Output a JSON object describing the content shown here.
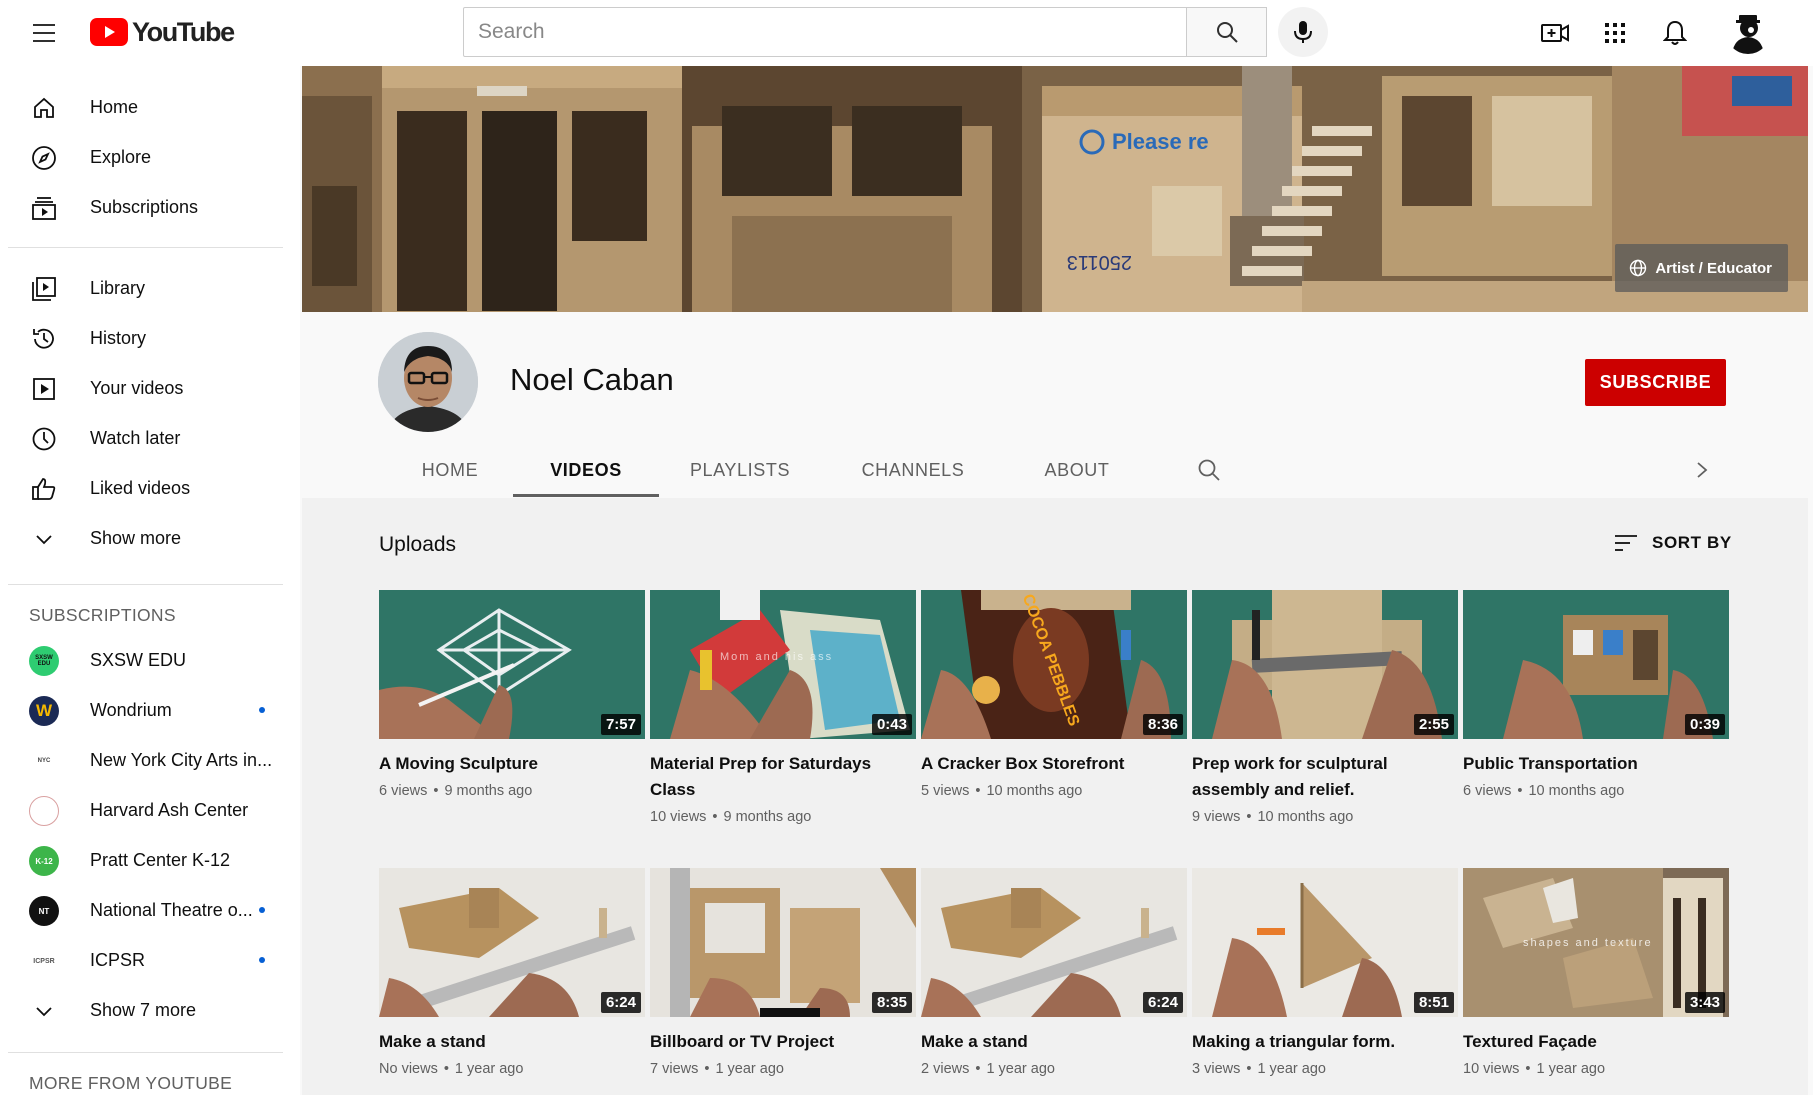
{
  "header": {
    "logo_text": "YouTube",
    "search_placeholder": "Search"
  },
  "sidebar": {
    "main": [
      {
        "label": "Home",
        "icon": "home-icon"
      },
      {
        "label": "Explore",
        "icon": "compass-icon"
      },
      {
        "label": "Subscriptions",
        "icon": "subscriptions-icon"
      }
    ],
    "library": [
      {
        "label": "Library",
        "icon": "library-icon"
      },
      {
        "label": "History",
        "icon": "history-icon"
      },
      {
        "label": "Your videos",
        "icon": "your-videos-icon"
      },
      {
        "label": "Watch later",
        "icon": "clock-icon"
      },
      {
        "label": "Liked videos",
        "icon": "thumbs-up-icon"
      },
      {
        "label": "Show more",
        "icon": "chevron-down-icon"
      }
    ],
    "subscriptions_heading": "SUBSCRIPTIONS",
    "subscriptions": [
      {
        "label": "SXSW EDU",
        "avatar_text": "SXSW EDU",
        "new": false
      },
      {
        "label": "Wondrium",
        "avatar_text": "W",
        "new": true
      },
      {
        "label": "New York City Arts in...",
        "avatar_text": "NYC",
        "new": false
      },
      {
        "label": "Harvard Ash Center",
        "avatar_text": "",
        "new": false
      },
      {
        "label": "Pratt Center K-12",
        "avatar_text": "K-12",
        "new": false
      },
      {
        "label": "National Theatre o...",
        "avatar_text": "NT",
        "new": true
      },
      {
        "label": "ICPSR",
        "avatar_text": "ICPSR",
        "new": true
      }
    ],
    "show_more_subs": "Show 7 more",
    "more_heading": "MORE FROM YOUTUBE"
  },
  "banner": {
    "badge": "Artist / Educator",
    "box_text": "Please re",
    "box_number": "250113"
  },
  "channel": {
    "name": "Noel Caban",
    "subscribe": "SUBSCRIBE",
    "tabs": [
      "HOME",
      "VIDEOS",
      "PLAYLISTS",
      "CHANNELS",
      "ABOUT"
    ],
    "active_tab": "VIDEOS"
  },
  "uploads": {
    "title": "Uploads",
    "sort_label": "SORT BY",
    "videos": [
      {
        "title": "A Moving Sculpture",
        "duration": "7:57",
        "views": "6 views",
        "age": "9 months ago"
      },
      {
        "title": "Material Prep for Saturdays Class",
        "duration": "0:43",
        "views": "10 views",
        "age": "9 months ago"
      },
      {
        "title": "A Cracker Box Storefront",
        "duration": "8:36",
        "views": "5 views",
        "age": "10 months ago"
      },
      {
        "title": "Prep work for sculptural assembly and relief.",
        "duration": "2:55",
        "views": "9 views",
        "age": "10 months ago"
      },
      {
        "title": "Public Transportation",
        "duration": "0:39",
        "views": "6 views",
        "age": "10 months ago"
      },
      {
        "title": "Make a stand",
        "duration": "6:24",
        "views": "No views",
        "age": "1 year ago"
      },
      {
        "title": "Billboard or TV Project",
        "duration": "8:35",
        "views": "7 views",
        "age": "1 year ago"
      },
      {
        "title": "Make a stand",
        "duration": "6:24",
        "views": "2 views",
        "age": "1 year ago"
      },
      {
        "title": "Making a triangular form.",
        "duration": "8:51",
        "views": "3 views",
        "age": "1 year ago"
      },
      {
        "title": "Textured Façade",
        "duration": "3:43",
        "views": "10 views",
        "age": "1 year ago"
      }
    ],
    "thumb_captions": [
      "Mom and his ass",
      "shapes and texture"
    ],
    "cereal_text": "COCOA PEBBLES"
  },
  "colors": {
    "brand_red": "#ff0000",
    "subscribe_red": "#cc0000",
    "notification_blue": "#065fd4",
    "thumbnail_green": "#2f7566"
  }
}
